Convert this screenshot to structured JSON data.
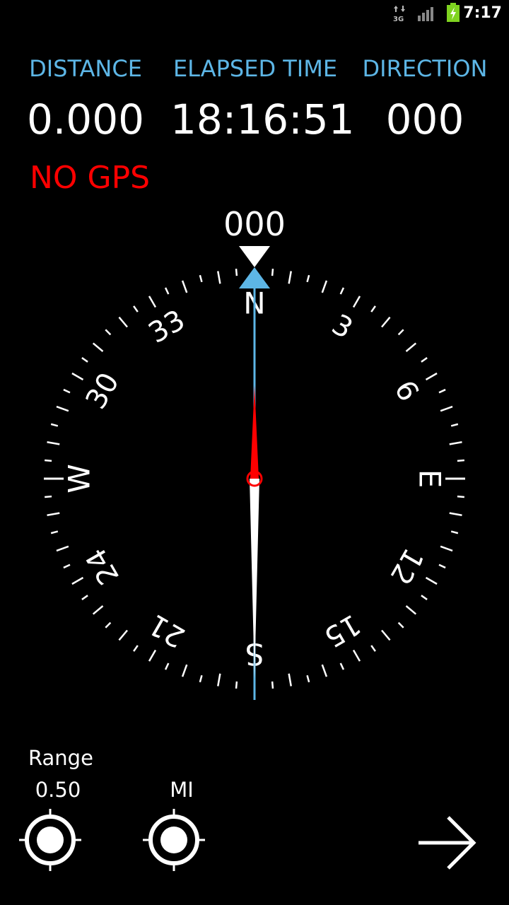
{
  "status_bar": {
    "time": "7:17",
    "network_type": "3G",
    "icons": [
      "data-arrows-icon",
      "signal-bars-icon",
      "battery-charging-icon"
    ],
    "battery_color": "#7fd320"
  },
  "stats": {
    "distance_label": "DISTANCE",
    "distance_value": "0.000",
    "elapsed_label": "ELAPSED TIME",
    "elapsed_value": "18:16:51",
    "direction_label": "DIRECTION",
    "direction_value": "000"
  },
  "gps_status": "NO GPS",
  "compass": {
    "heading_readout": "000",
    "cardinals": [
      "N",
      "E",
      "S",
      "W"
    ],
    "bearing_labels": [
      "3",
      "6",
      "12",
      "15",
      "21",
      "24",
      "30",
      "33"
    ],
    "needle_north_color": "#ff0000",
    "needle_south_color": "#ffffff",
    "bearing_line_color": "#5db6e6",
    "marker_color": "#5db6e6"
  },
  "controls": {
    "range_label": "Range",
    "range_value": "0.50",
    "unit_label": "MI",
    "icons": [
      "range-target-icon",
      "unit-target-icon",
      "arrow-right-icon"
    ]
  },
  "colors": {
    "label_blue": "#5db6e6",
    "alert_red": "#ff0000",
    "background": "#000000"
  }
}
